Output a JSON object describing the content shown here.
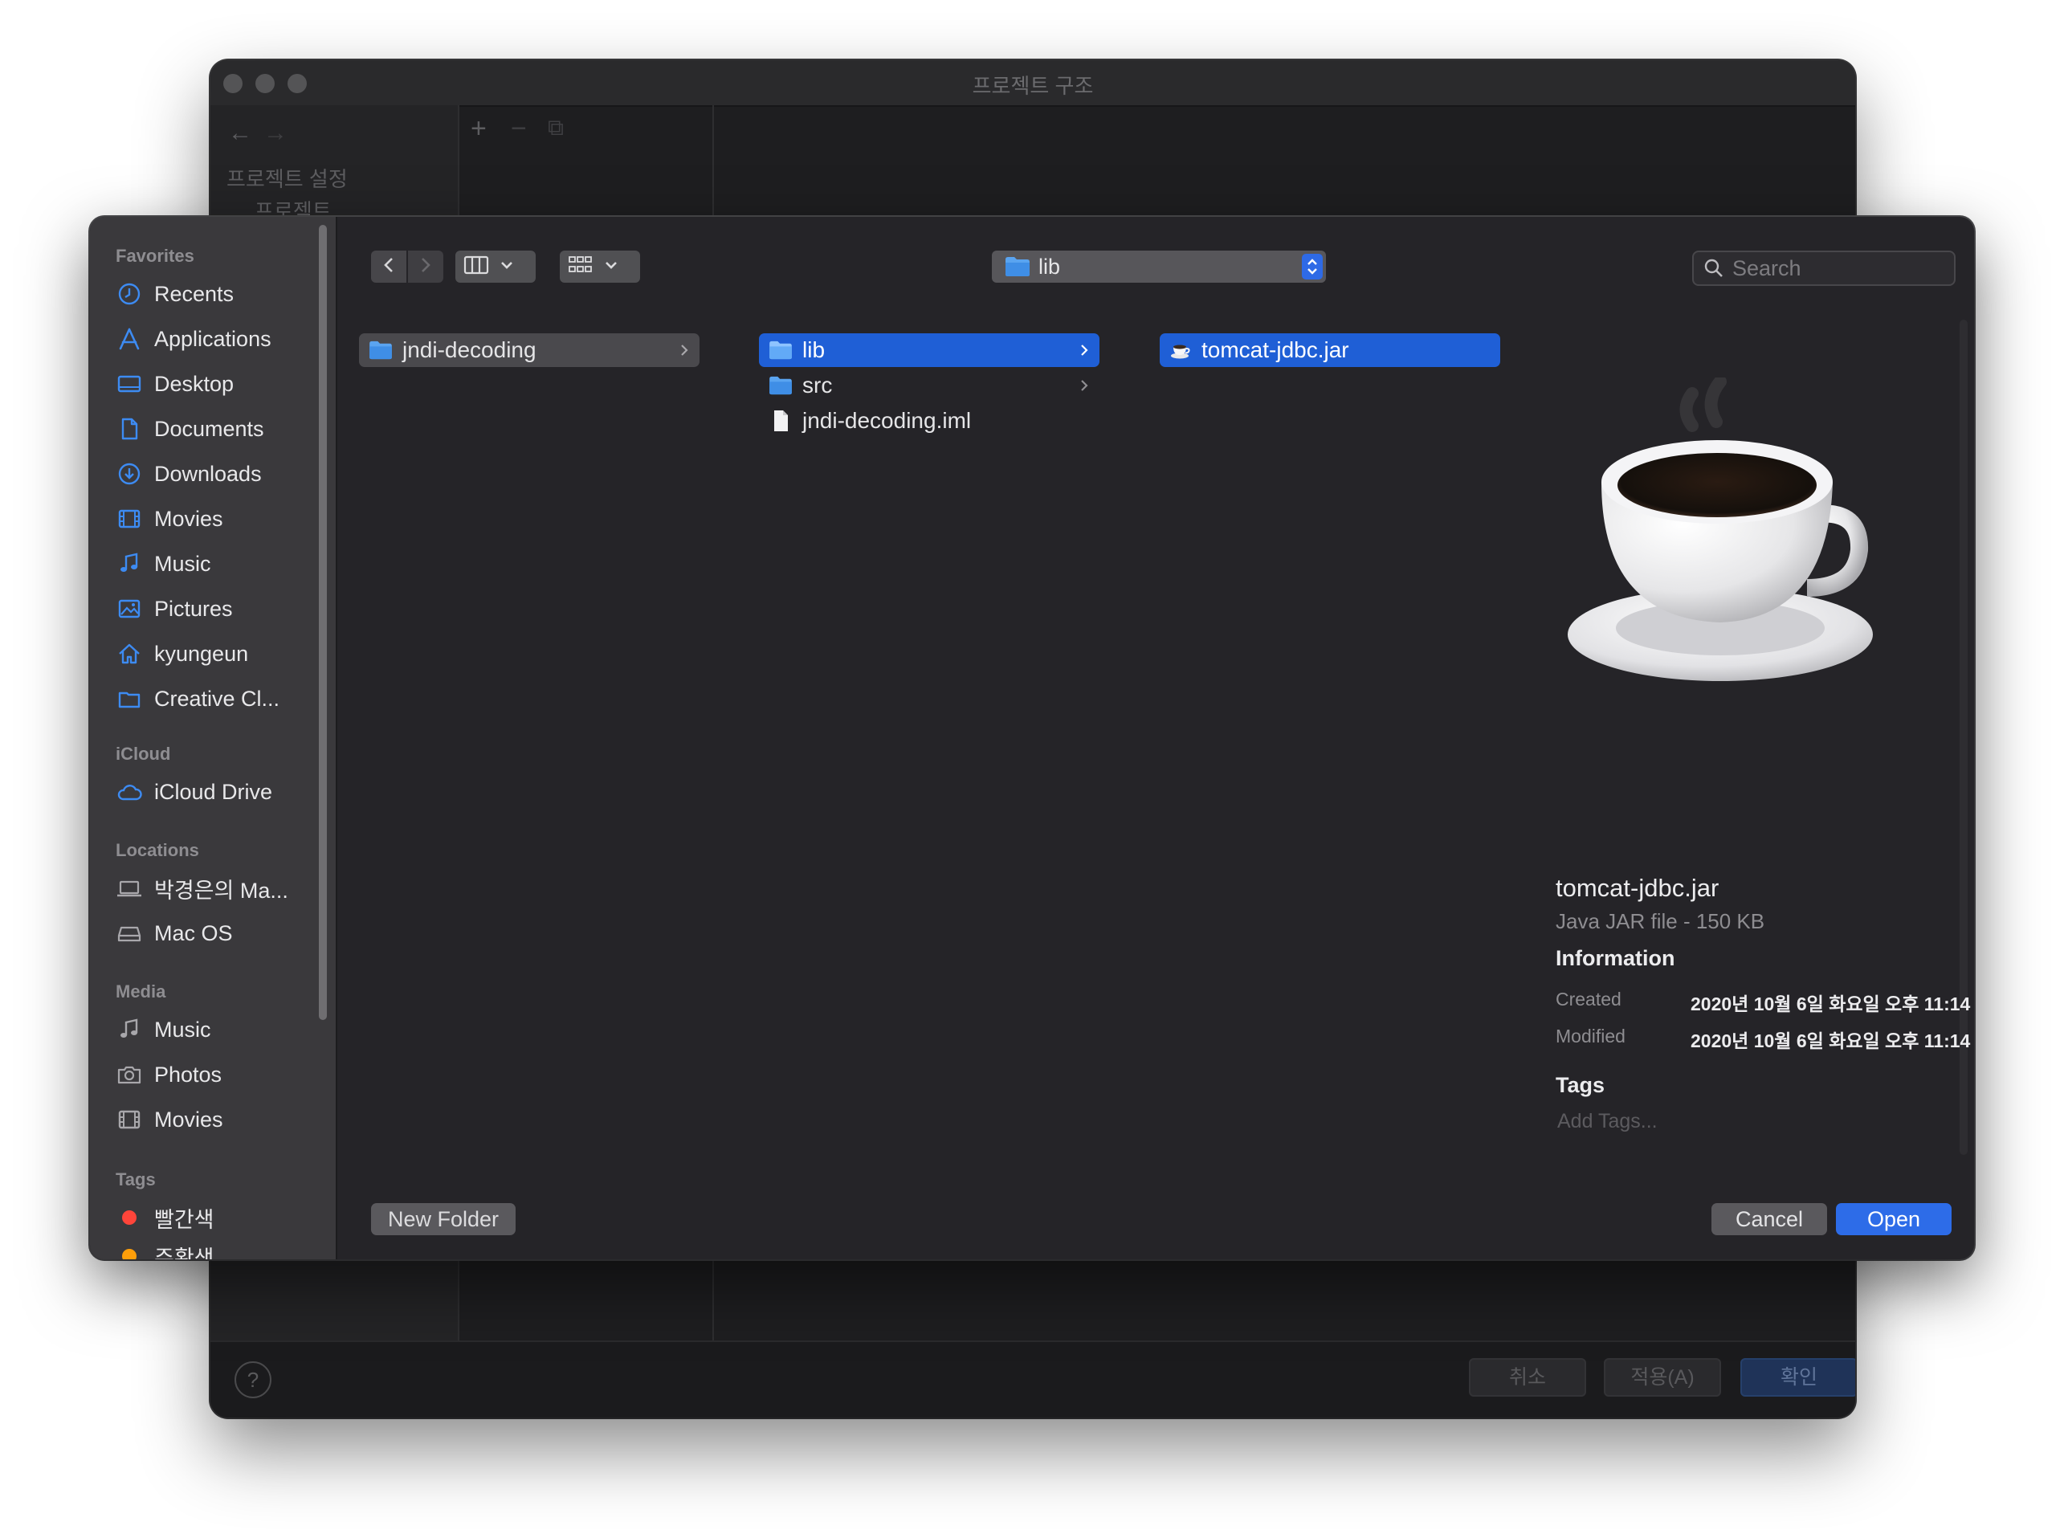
{
  "background_window": {
    "title": "프로젝트 구조",
    "nav_heading": "프로젝트 설정",
    "nav_item": "프로젝트",
    "help_label": "?",
    "buttons": {
      "cancel": "취소",
      "apply": "적용(A)",
      "ok": "확인"
    }
  },
  "sidebar": {
    "favorites_title": "Favorites",
    "favorites": [
      {
        "label": "Recents",
        "icon": "clock-icon"
      },
      {
        "label": "Applications",
        "icon": "applications-icon"
      },
      {
        "label": "Desktop",
        "icon": "desktop-icon"
      },
      {
        "label": "Documents",
        "icon": "document-icon"
      },
      {
        "label": "Downloads",
        "icon": "download-icon"
      },
      {
        "label": "Movies",
        "icon": "film-icon"
      },
      {
        "label": "Music",
        "icon": "music-note-icon"
      },
      {
        "label": "Pictures",
        "icon": "pictures-icon"
      },
      {
        "label": "kyungeun",
        "icon": "home-icon"
      },
      {
        "label": "Creative Cl...",
        "icon": "folder-icon"
      }
    ],
    "icloud_title": "iCloud",
    "icloud": [
      {
        "label": "iCloud Drive",
        "icon": "cloud-icon"
      }
    ],
    "locations_title": "Locations",
    "locations": [
      {
        "label": "박경은의 Ma...",
        "icon": "laptop-icon"
      },
      {
        "label": "Mac OS",
        "icon": "disk-icon"
      }
    ],
    "media_title": "Media",
    "media": [
      {
        "label": "Music",
        "icon": "music-note-icon"
      },
      {
        "label": "Photos",
        "icon": "camera-icon"
      },
      {
        "label": "Movies",
        "icon": "film-icon"
      }
    ],
    "tags_title": "Tags",
    "tags": [
      {
        "label": "빨간색",
        "color": "#ff453a"
      },
      {
        "label": "주황색",
        "color": "#ff9f0a"
      }
    ]
  },
  "toolbar": {
    "path_label": "lib",
    "search_placeholder": "Search"
  },
  "columns": {
    "col1": [
      {
        "label": "jndi-decoding",
        "type": "folder",
        "selected": "gray",
        "has_children": true
      }
    ],
    "col2": [
      {
        "label": "lib",
        "type": "folder",
        "selected": "blue",
        "has_children": true
      },
      {
        "label": "src",
        "type": "folder",
        "selected": "none",
        "has_children": true
      },
      {
        "label": "jndi-decoding.iml",
        "type": "file",
        "selected": "none",
        "has_children": false
      }
    ],
    "col3": [
      {
        "label": "tomcat-jdbc.jar",
        "type": "jar",
        "selected": "blue",
        "has_children": false
      }
    ]
  },
  "preview": {
    "filename": "tomcat-jdbc.jar",
    "kind": "Java JAR file - 150 KB",
    "info_heading": "Information",
    "created_label": "Created",
    "created_value": "2020년 10월 6일 화요일 오후 11:14",
    "modified_label": "Modified",
    "modified_value": "2020년 10월 6일 화요일 오후 11:14",
    "tags_heading": "Tags",
    "tags_placeholder": "Add Tags..."
  },
  "buttons": {
    "new_folder": "New Folder",
    "cancel": "Cancel",
    "open": "Open"
  },
  "colors": {
    "accent_blue": "#1f5fd6",
    "sidebar_icon_blue": "#3d8bf2"
  }
}
